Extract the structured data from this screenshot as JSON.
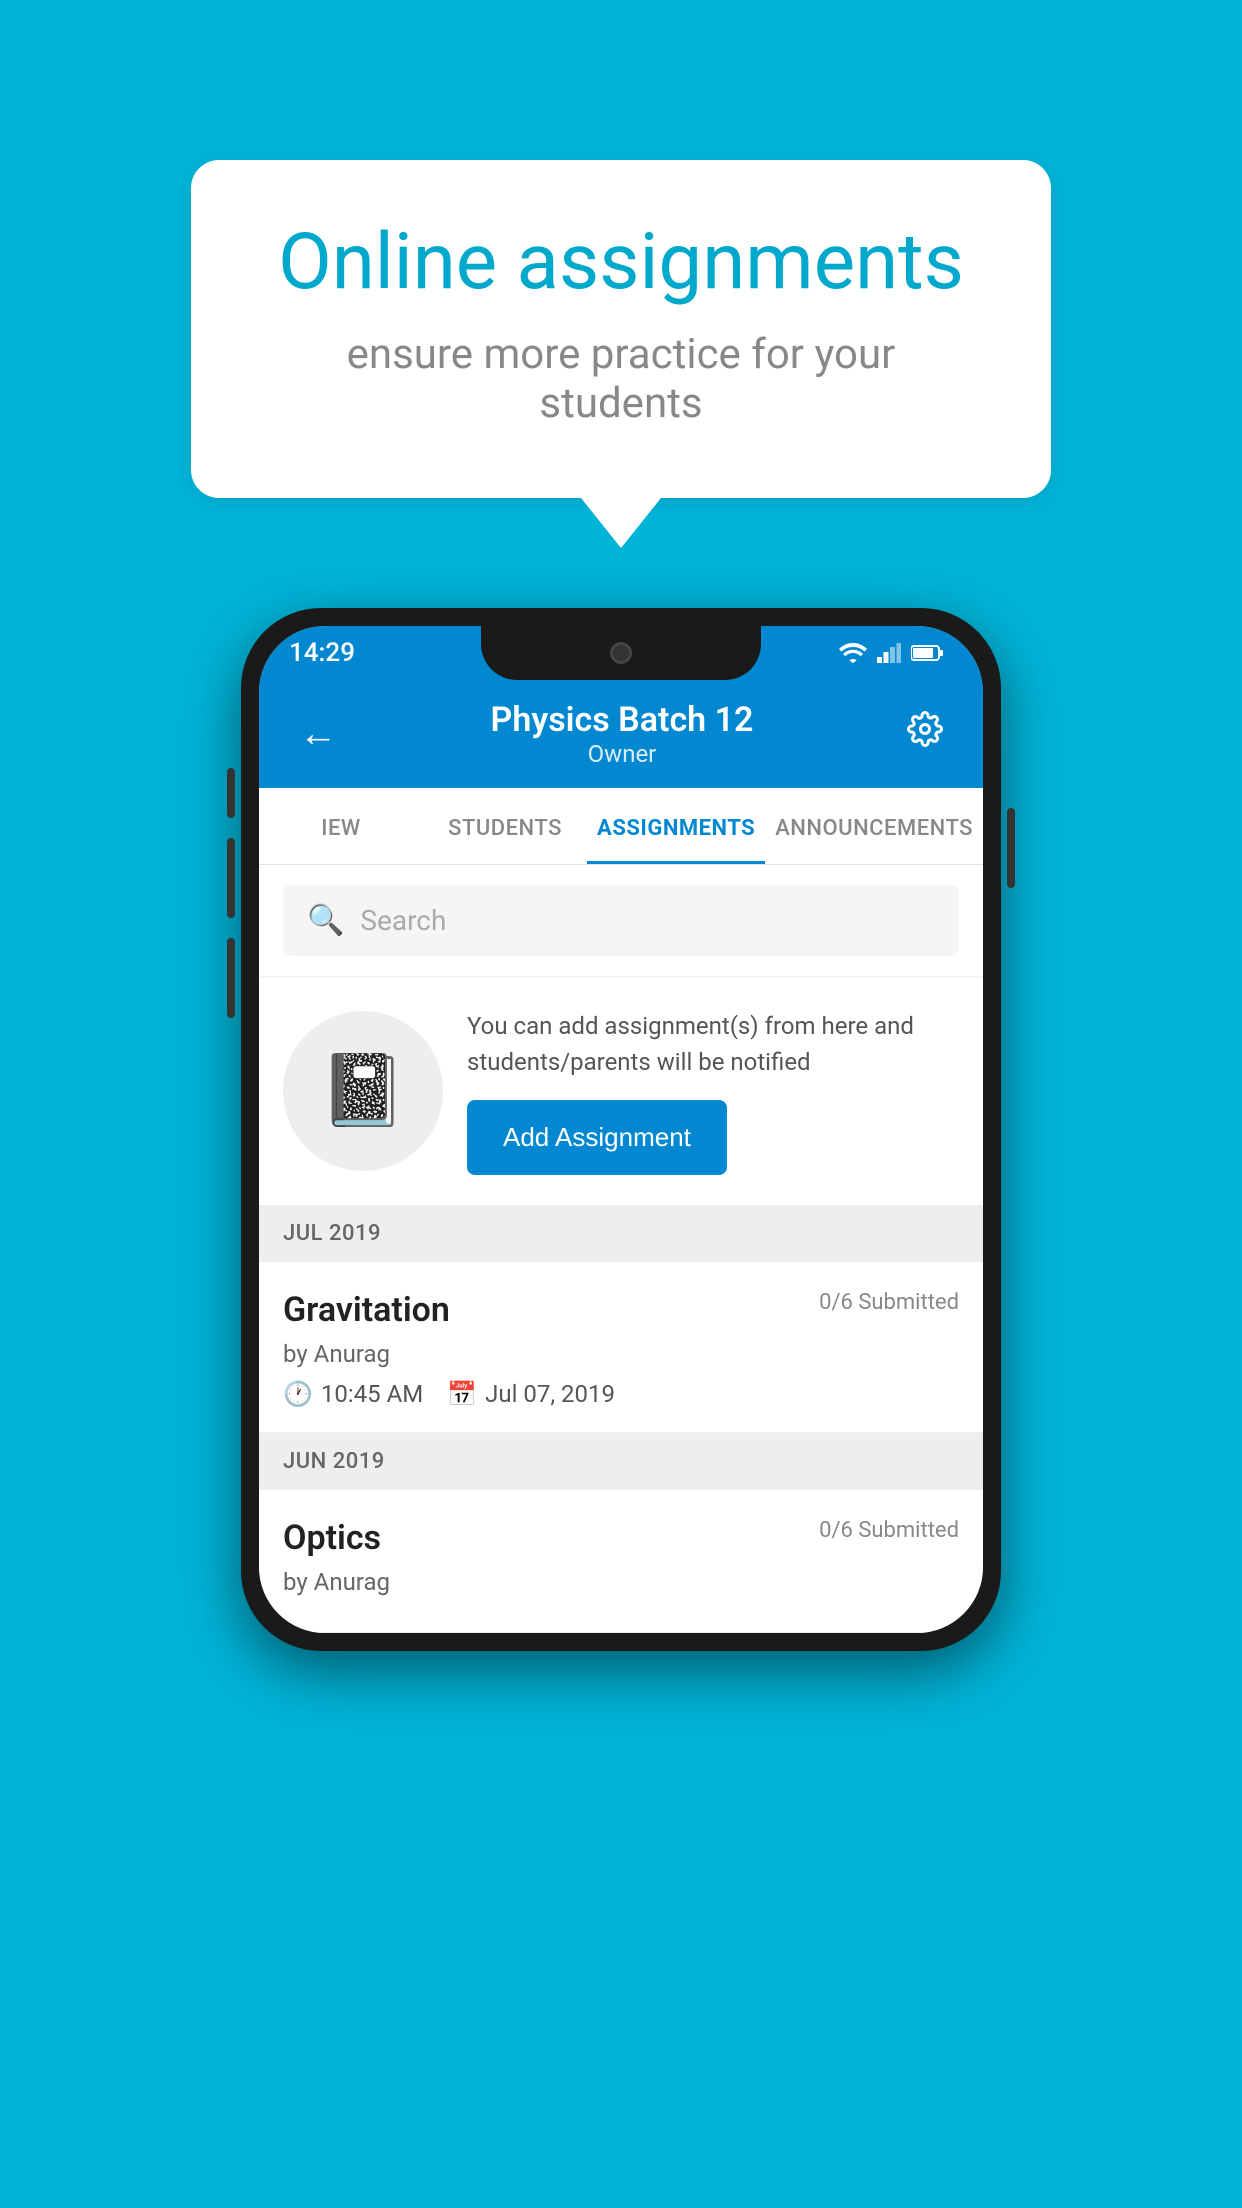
{
  "background_color": "#00b4d8",
  "speech_bubble": {
    "title": "Online assignments",
    "subtitle": "ensure more practice for your students"
  },
  "phone": {
    "status_bar": {
      "time": "14:29",
      "icons": [
        "wifi",
        "signal",
        "battery"
      ]
    },
    "app_bar": {
      "title": "Physics Batch 12",
      "subtitle": "Owner",
      "back_label": "←",
      "settings_label": "⚙"
    },
    "tabs": [
      {
        "label": "IEW",
        "active": false
      },
      {
        "label": "STUDENTS",
        "active": false
      },
      {
        "label": "ASSIGNMENTS",
        "active": true
      },
      {
        "label": "ANNOUNCEMENTS",
        "active": false
      }
    ],
    "search": {
      "placeholder": "Search"
    },
    "info_card": {
      "description": "You can add assignment(s) from here and students/parents will be notified",
      "button_label": "Add Assignment"
    },
    "sections": [
      {
        "month_label": "JUL 2019",
        "assignments": [
          {
            "title": "Gravitation",
            "submitted": "0/6 Submitted",
            "by": "by Anurag",
            "time": "10:45 AM",
            "date": "Jul 07, 2019"
          }
        ]
      },
      {
        "month_label": "JUN 2019",
        "assignments": [
          {
            "title": "Optics",
            "submitted": "0/6 Submitted",
            "by": "by Anurag",
            "time": "",
            "date": ""
          }
        ]
      }
    ]
  }
}
